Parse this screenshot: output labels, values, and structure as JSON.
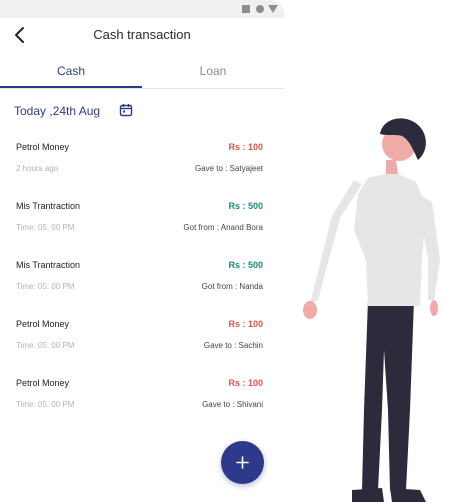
{
  "header": {
    "title": "Cash transaction"
  },
  "tabs": [
    {
      "label": "Cash",
      "active": true
    },
    {
      "label": "Loan",
      "active": false
    }
  ],
  "date": {
    "label": "Today ,24th Aug"
  },
  "transactions": [
    {
      "title": "Petrol Money",
      "amount": "Rs : 100",
      "direction": "out",
      "time": "2 hours ago",
      "party": "Gave to : Satyajeet"
    },
    {
      "title": "Mis Trantraction",
      "amount": "Rs : 500",
      "direction": "in",
      "time": "Time: 05: 00 PM",
      "party": "Got from : Anand Bora"
    },
    {
      "title": "Mis Trantraction",
      "amount": "Rs : 500",
      "direction": "in",
      "time": "Time: 05: 00 PM",
      "party": "Got from : Nanda"
    },
    {
      "title": "Petrol Money",
      "amount": "Rs : 100",
      "direction": "out",
      "time": "Time: 05: 00 PM",
      "party": "Gave to : Sachin"
    },
    {
      "title": "Petrol Money",
      "amount": "Rs : 100",
      "direction": "out",
      "time": "Time: 05: 00 PM",
      "party": "Gave to : Shivani"
    }
  ],
  "icons": {
    "back": "chevron-left-icon",
    "calendar": "calendar-icon",
    "fab": "plus-icon",
    "status_bar": [
      "square-icon",
      "circle-icon",
      "triangle-icon"
    ]
  },
  "colors": {
    "accent": "#2d3a8c",
    "amount_out": "#d9534f",
    "amount_in": "#1a8c7a",
    "status_bar": "#f0f0f0"
  }
}
